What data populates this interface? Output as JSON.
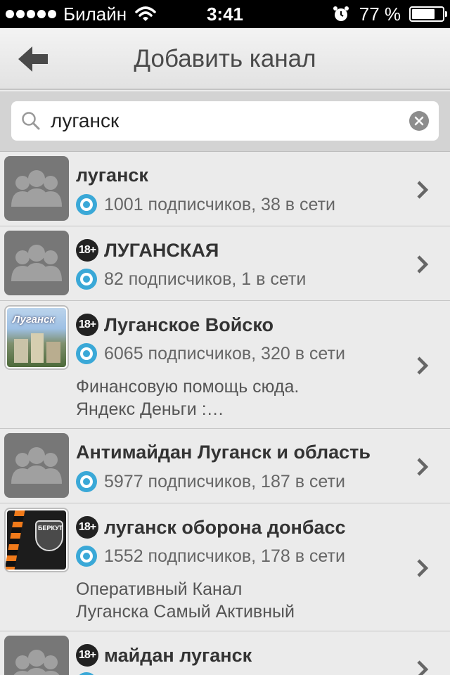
{
  "status_bar": {
    "carrier": "Билайн",
    "time": "3:41",
    "battery_percent": "77 %",
    "battery_level": 0.77,
    "icons": [
      "signal-dots-icon",
      "wifi-icon",
      "alarm-icon",
      "battery-icon"
    ]
  },
  "nav": {
    "title": "Добавить канал",
    "back_icon": "back-arrow-icon"
  },
  "search": {
    "value": "луганск",
    "placeholder": "",
    "search_icon": "search-icon",
    "clear_icon": "clear-icon"
  },
  "channels": [
    {
      "title": "луганск",
      "adult": false,
      "age_label": "",
      "stats": "1001 подписчиков, 38 в сети",
      "description": "",
      "thumbnail": "placeholder"
    },
    {
      "title": "ЛУГАНСКАЯ",
      "adult": true,
      "age_label": "18+",
      "stats": "82 подписчиков, 1 в сети",
      "description": "",
      "thumbnail": "placeholder"
    },
    {
      "title": "Луганское Войско",
      "adult": true,
      "age_label": "18+",
      "stats": "6065 подписчиков, 320 в сети",
      "description_line1": "Финансовую помощь сюда.",
      "description_line2": "Яндекс Деньги :…",
      "thumbnail": "photo-city",
      "thumbnail_caption": "Луганск"
    },
    {
      "title": "Антимайдан Луганск и область",
      "adult": false,
      "age_label": "",
      "stats": "5977 подписчиков, 187 в сети",
      "description": "",
      "thumbnail": "placeholder"
    },
    {
      "title": "луганск оборона донбасс",
      "adult": true,
      "age_label": "18+",
      "stats": "1552 подписчиков, 178 в сети",
      "description_line1": "Оперативный Канал",
      "description_line2": "Луганска Самый Активный",
      "thumbnail": "photo-ribbon",
      "thumbnail_caption": "БЕРКУТ"
    },
    {
      "title": "майдан луганск",
      "adult": true,
      "age_label": "18+",
      "stats": "",
      "description": "",
      "thumbnail": "placeholder"
    }
  ],
  "colors": {
    "accent_blue": "#3aa8d7",
    "badge_dark": "#222222",
    "placeholder_gray": "#777777",
    "background": "#ebebeb"
  }
}
